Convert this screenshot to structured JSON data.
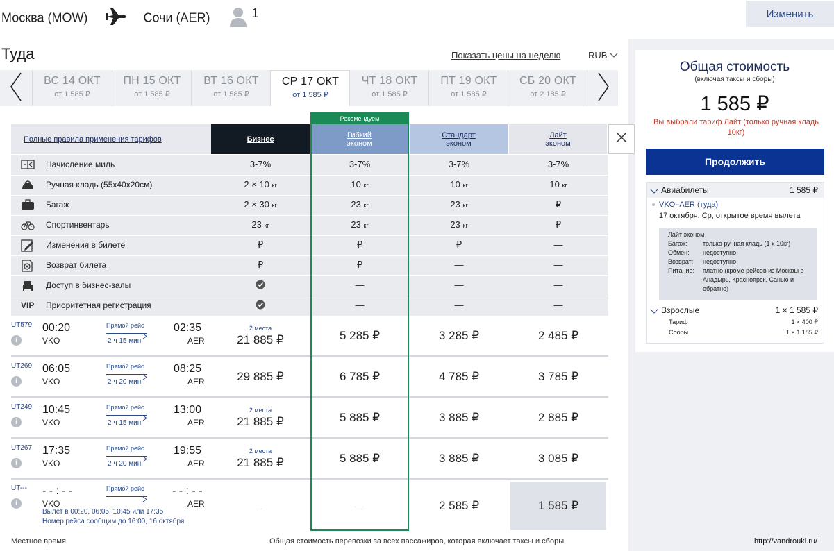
{
  "header": {
    "origin": "Москва (MOW)",
    "destination": "Сочи (AER)",
    "passengers": "1",
    "change_label": "Изменить"
  },
  "page": {
    "direction_title": "Туда",
    "week_prices_link": "Показать цены на неделю",
    "currency": "RUB"
  },
  "dates": [
    {
      "day": "ВС 14 ОКТ",
      "price": "от 1 585 ₽",
      "active": false
    },
    {
      "day": "ПН 15 ОКТ",
      "price": "от 1 585 ₽",
      "active": false
    },
    {
      "day": "ВТ 16 ОКТ",
      "price": "от 1 585 ₽",
      "active": false
    },
    {
      "day": "СР 17 ОКТ",
      "price": "от 1 585 ₽",
      "active": true
    },
    {
      "day": "ЧТ 18 ОКТ",
      "price": "от 1 585 ₽",
      "active": false
    },
    {
      "day": "ПТ 19 ОКТ",
      "price": "от 1 585 ₽",
      "active": false
    },
    {
      "day": "СБ 20 ОКТ",
      "price": "от 2 185 ₽",
      "active": false
    }
  ],
  "fares": {
    "rules_link": "Полные правила применения тарифов",
    "recommended": "Рекомендуем",
    "columns": [
      {
        "name": "Бизнес",
        "sub": "",
        "bg": "#121a24",
        "color": "#ffffff"
      },
      {
        "name": "Гибкий",
        "sub": "эконом",
        "bg": "#7e9ac6",
        "color": "#ffffff"
      },
      {
        "name": "Стандарт",
        "sub": "эконом",
        "bg": "#b4c6e2",
        "color": "#1a2a5a"
      },
      {
        "name": "Лайт",
        "sub": "эконом",
        "bg": "#e4e6eb",
        "color": "#1a2a5a"
      }
    ],
    "features": [
      {
        "icon": "miles-icon",
        "label": "Начисление миль",
        "values": [
          "3-7%",
          "3-7%",
          "3-7%",
          "3-7%"
        ]
      },
      {
        "icon": "handbag-icon",
        "label": "Ручная кладь (55x40x20см)",
        "values": [
          "2 × 10|кг",
          "10|кг",
          "10|кг",
          "10|кг"
        ]
      },
      {
        "icon": "suitcase-icon",
        "label": "Багаж",
        "values": [
          "2 × 30|кг",
          "23|кг",
          "23|кг",
          "₽"
        ]
      },
      {
        "icon": "bicycle-icon",
        "label": "Спортинвентарь",
        "values": [
          "23|кг",
          "23|кг",
          "23|кг",
          "₽"
        ]
      },
      {
        "icon": "edit-ticket-icon",
        "label": "Изменения в билете",
        "values": [
          "₽",
          "₽",
          "₽",
          "—"
        ]
      },
      {
        "icon": "refund-icon",
        "label": "Возврат билета",
        "values": [
          "₽",
          "₽",
          "—",
          "—"
        ]
      },
      {
        "icon": "lounge-icon",
        "label": "Доступ в бизнес-залы",
        "values": [
          "check",
          "—",
          "—",
          "—"
        ]
      },
      {
        "icon": "vip-icon",
        "label": "Приоритетная регистрация",
        "values": [
          "check",
          "—",
          "—",
          "—"
        ]
      }
    ]
  },
  "flights": [
    {
      "no": "UT579",
      "dep": "00:20",
      "from": "VKO",
      "direct": "Прямой рейс",
      "dur": "2 ч 15 мин",
      "arr": "02:35",
      "to": "AER",
      "seats": "2 места",
      "prices": [
        "21 885 ₽",
        "5 285 ₽",
        "3 285 ₽",
        "2 485 ₽"
      ]
    },
    {
      "no": "UT269",
      "dep": "06:05",
      "from": "VKO",
      "direct": "Прямой рейс",
      "dur": "2 ч 20 мин",
      "arr": "08:25",
      "to": "AER",
      "seats": "",
      "prices": [
        "29 885 ₽",
        "6 785 ₽",
        "4 785 ₽",
        "3 785 ₽"
      ]
    },
    {
      "no": "UT249",
      "dep": "10:45",
      "from": "VKO",
      "direct": "Прямой рейс",
      "dur": "2 ч 15 мин",
      "arr": "13:00",
      "to": "AER",
      "seats": "2 места",
      "prices": [
        "21 885 ₽",
        "5 885 ₽",
        "3 885 ₽",
        "2 885 ₽"
      ]
    },
    {
      "no": "UT267",
      "dep": "17:35",
      "from": "VKO",
      "direct": "Прямой рейс",
      "dur": "2 ч 20 мин",
      "arr": "19:55",
      "to": "AER",
      "seats": "2 места",
      "prices": [
        "21 885 ₽",
        "5 885 ₽",
        "3 885 ₽",
        "3 085 ₽"
      ]
    }
  ],
  "open_flight": {
    "no": "UT---",
    "dep": "- - : - -",
    "from": "VKO",
    "direct": "Прямой рейс",
    "arr": "- - : - -",
    "to": "AER",
    "note1": "Вылет в 00:20, 06:05, 10:45 или 17:35",
    "note2": "Номер рейса сообщим до 16:00, 16 октября",
    "prices": [
      "—",
      "—",
      "2 585 ₽",
      "1 585 ₽"
    ]
  },
  "footer": {
    "left": "Местное время",
    "right": "Общая стоимость перевозки за всех пассажиров, которая включает таксы и сборы",
    "watermark": "http://vandrouki.ru/"
  },
  "summary": {
    "title": "Общая стоимость",
    "subtitle": "(включая таксы и сборы)",
    "total": "1 585 ₽",
    "note": "Вы выбрали тариф Лайт (только ручная кладь 10кг)",
    "continue_label": "Продолжить",
    "tickets_label": "Авиабилеты",
    "tickets_price": "1 585 ₽",
    "segment": "VKO–AER (туда)",
    "segment_date": "17 октября, Ср, открытое время вылета",
    "fare_name": "Лайт эконом",
    "details": [
      {
        "k": "Багаж:",
        "v": "только ручная кладь (1 x 10кг)"
      },
      {
        "k": "Обмен:",
        "v": "недоступно"
      },
      {
        "k": "Возврат:",
        "v": "недоступно"
      },
      {
        "k": "Питание:",
        "v": "платно (кроме рейсов из Москвы в Анадырь, Красноярск, Санью и обратно)"
      }
    ],
    "adults_label": "Взрослые",
    "adults_value": "1 × 1 585 ₽",
    "tariff_label": "Тариф",
    "tariff_value": "1 × 400 ₽",
    "fees_label": "Сборы",
    "fees_value": "1 × 1 185 ₽"
  }
}
